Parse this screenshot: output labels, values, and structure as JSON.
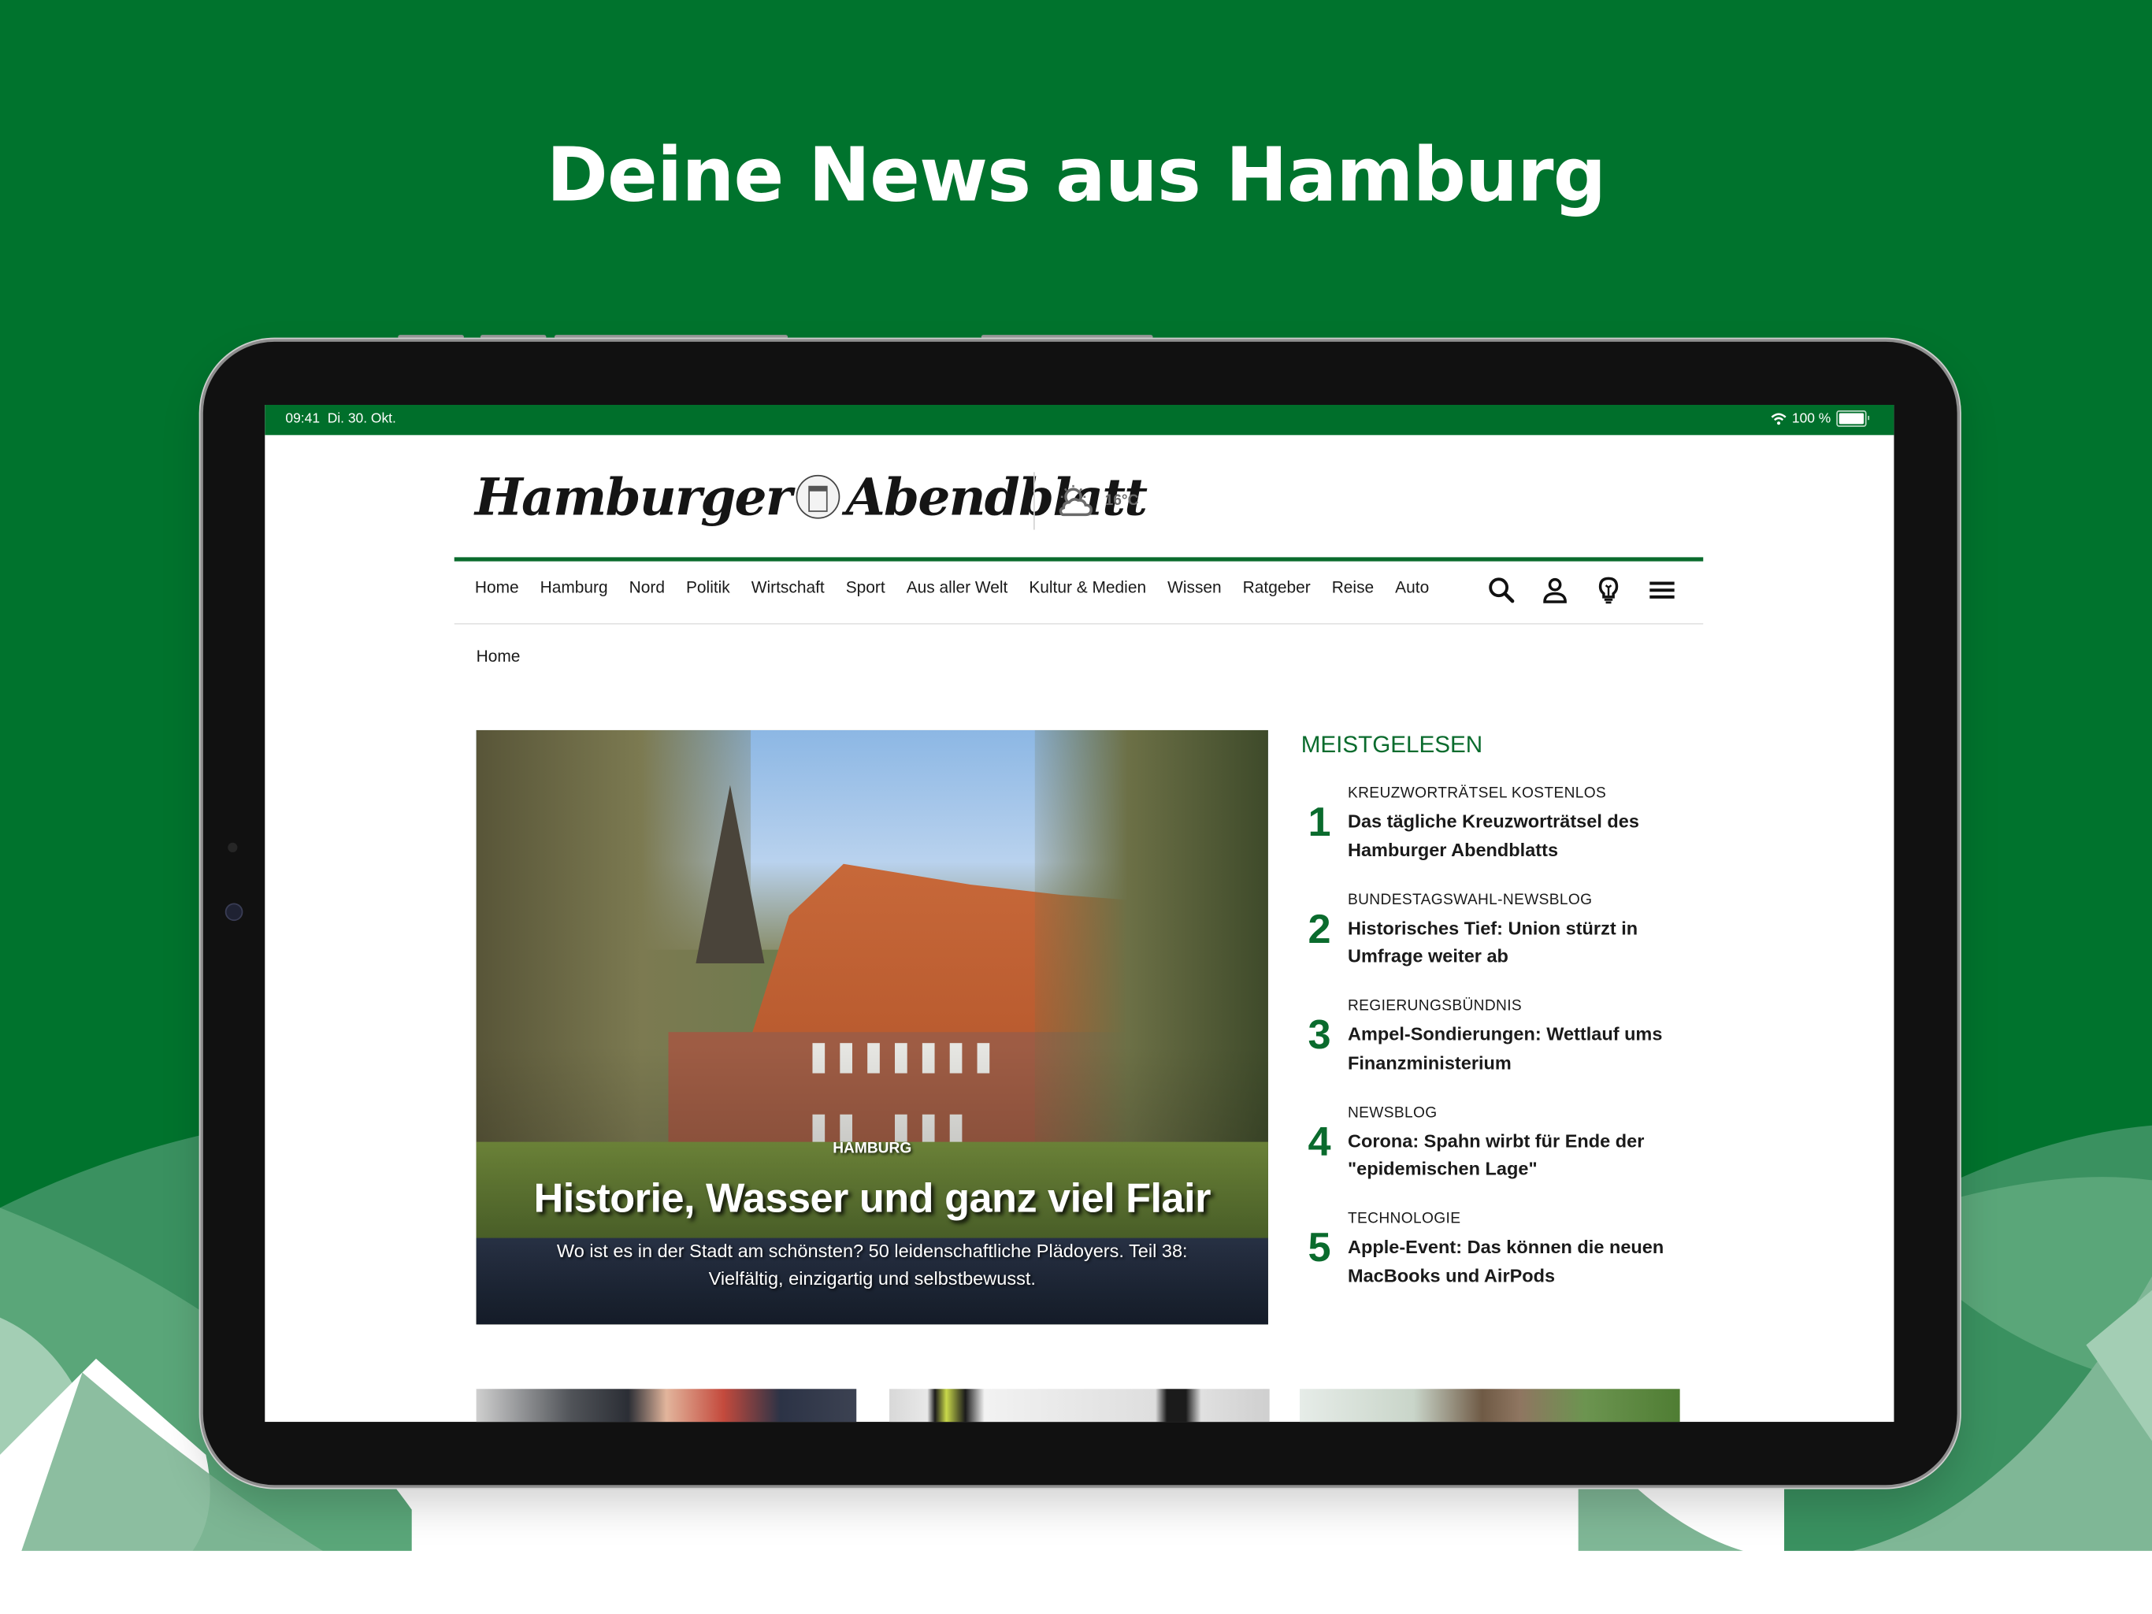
{
  "promo": {
    "headline": "Deine News aus Hamburg",
    "colors": {
      "brand_green": "#006f2b",
      "accent_green": "#0a6b2d",
      "light_green": "#7fb796"
    }
  },
  "statusbar": {
    "time": "09:41",
    "date": "Di. 30. Okt.",
    "battery_text": "100 %",
    "battery_level": 1.0,
    "wifi_icon": "wifi-icon"
  },
  "header": {
    "logo_left": "Hamburger",
    "logo_right": "Abendblatt",
    "weather": {
      "icon": "partly-cloudy-icon",
      "temperature": "16°C"
    }
  },
  "nav": {
    "items": [
      "Home",
      "Hamburg",
      "Nord",
      "Politik",
      "Wirtschaft",
      "Sport",
      "Aus aller Welt",
      "Kultur & Medien",
      "Wissen",
      "Ratgeber",
      "Reise",
      "Auto"
    ],
    "icons": [
      "search-icon",
      "account-icon",
      "lightbulb-icon",
      "menu-icon"
    ]
  },
  "breadcrumb": {
    "current": "Home"
  },
  "hero": {
    "kicker": "HAMBURG",
    "title": "Historie, Wasser und ganz viel Flair",
    "teaser": "Wo ist es in der Stadt am schönsten? 50 leidenschaftliche Plädoyers. Teil 38: Vielfältig, einzigartig und selbstbewusst."
  },
  "meistgelesen": {
    "title": "MEISTGELESEN",
    "items": [
      {
        "rank": "1",
        "kicker": "KREUZWORTRÄTSEL KOSTENLOS",
        "headline": "Das tägliche Kreuzworträtsel des Hamburger Abendblatts"
      },
      {
        "rank": "2",
        "kicker": "BUNDESTAGSWAHL-NEWSBLOG",
        "headline": "Historisches Tief: Union stürzt in Umfrage weiter ab"
      },
      {
        "rank": "3",
        "kicker": "REGIERUNGSBÜNDNIS",
        "headline": "Ampel-Sondierungen: Wettlauf ums Finanzministerium"
      },
      {
        "rank": "4",
        "kicker": "NEWSBLOG",
        "headline": "Corona: Spahn wirbt für Ende der \"epidemischen Lage\""
      },
      {
        "rank": "5",
        "kicker": "TECHNOLOGIE",
        "headline": "Apple-Event: Das können die neuen MacBooks und AirPods"
      }
    ]
  }
}
